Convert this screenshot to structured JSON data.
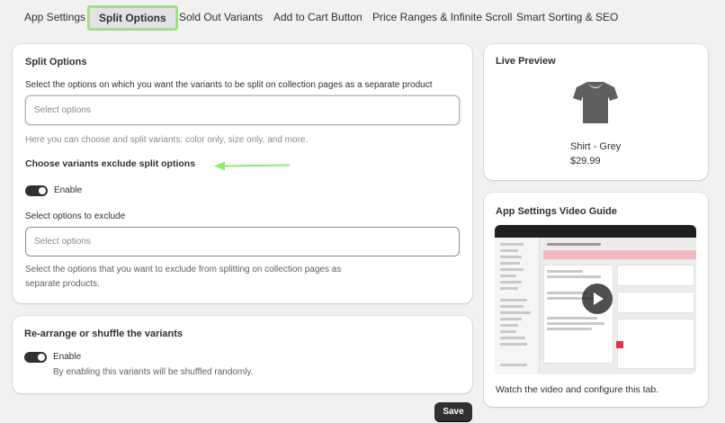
{
  "tabs": [
    {
      "label": "App Settings"
    },
    {
      "label": "Split Options"
    },
    {
      "label": "Sold Out Variants"
    },
    {
      "label": "Add to Cart Button"
    },
    {
      "label": "Price Ranges & Infinite Scroll"
    },
    {
      "label": "Smart Sorting & SEO"
    }
  ],
  "active_tab": "Split Options",
  "split": {
    "title": "Split Options",
    "description": "Select the options on which you want the variants to be split on collection pages as a separate product",
    "select_placeholder": "Select options",
    "help": "Here you can choose and split variants: color only, size only, and more.",
    "exclude_heading": "Choose variants exclude split options",
    "enable_label": "Enable",
    "exclude_label": "Select options to exclude",
    "exclude_placeholder": "Select options",
    "exclude_help_1": "Select the options that you want to exclude from splitting on collection pages as",
    "exclude_help_2": "separate products."
  },
  "shuffle": {
    "title": "Re-arrange or shuffle the variants",
    "enable_label": "Enable",
    "help": "By enabling this variants will be shuffled randomly."
  },
  "save_label": "Save",
  "preview": {
    "title": "Live Preview",
    "product_name": "Shirt - Grey",
    "price": "$29.99"
  },
  "video_guide": {
    "title": "App Settings Video Guide",
    "caption": "Watch the video and configure this tab."
  },
  "colors": {
    "accent_highlight": "#8eea6e",
    "toggle_on": "#303030",
    "primary_button": "#303030"
  }
}
